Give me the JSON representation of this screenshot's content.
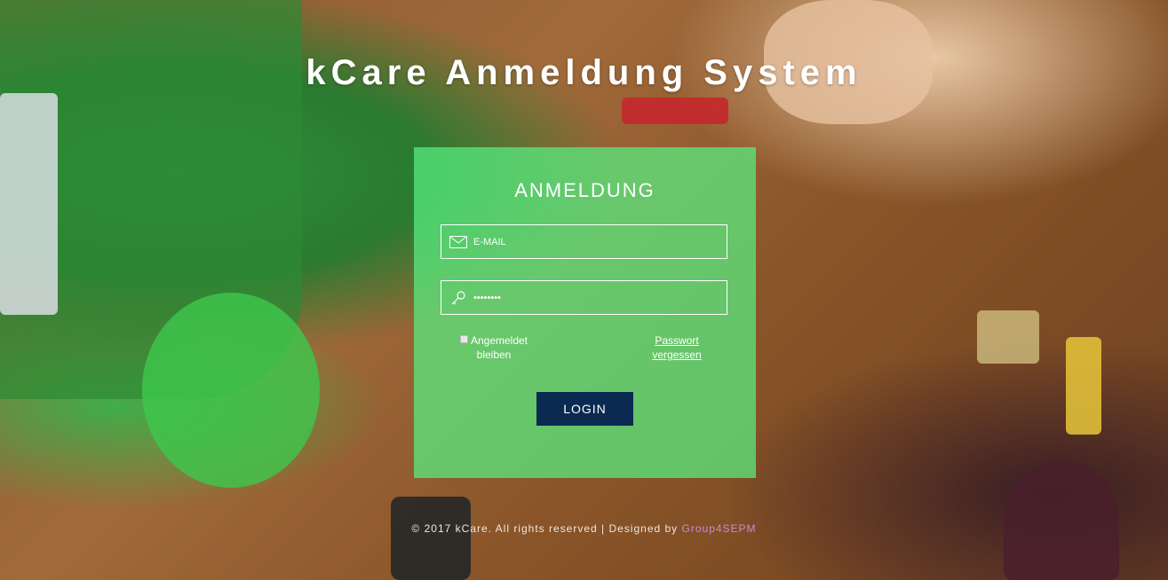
{
  "page": {
    "title": "kCare Anmeldung System"
  },
  "login": {
    "heading": "ANMELDUNG",
    "email_placeholder": "E-MAIL",
    "password_value": "••••••••",
    "remember_label": "Angemeldet bleiben",
    "forgot_label": "Passwort vergessen",
    "button_label": "LOGIN"
  },
  "footer": {
    "text": "© 2017 kCare. All rights reserved | Designed by ",
    "link_text": "Group4SEPM"
  },
  "colors": {
    "panel": "#58f082",
    "button": "#0b2a52",
    "footer_link": "#c78bd3"
  },
  "icons": {
    "email": "envelope-icon",
    "password": "key-icon"
  }
}
